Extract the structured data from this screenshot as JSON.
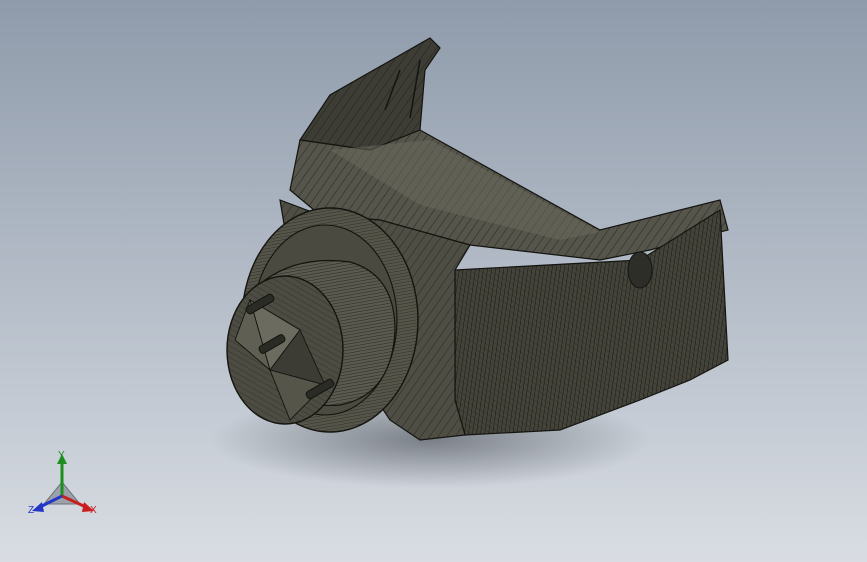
{
  "viewport": {
    "background_top": "#8f9bab",
    "background_bottom": "#d9dde3"
  },
  "model": {
    "shade": "#4a4a40",
    "edge": "#141410"
  },
  "triad": {
    "x_label": "X",
    "y_label": "Y",
    "z_label": "Z",
    "x_color": "#c81e1e",
    "y_color": "#1c8f1c",
    "z_color": "#2436c8",
    "icon": "coordinate-triad-icon"
  }
}
